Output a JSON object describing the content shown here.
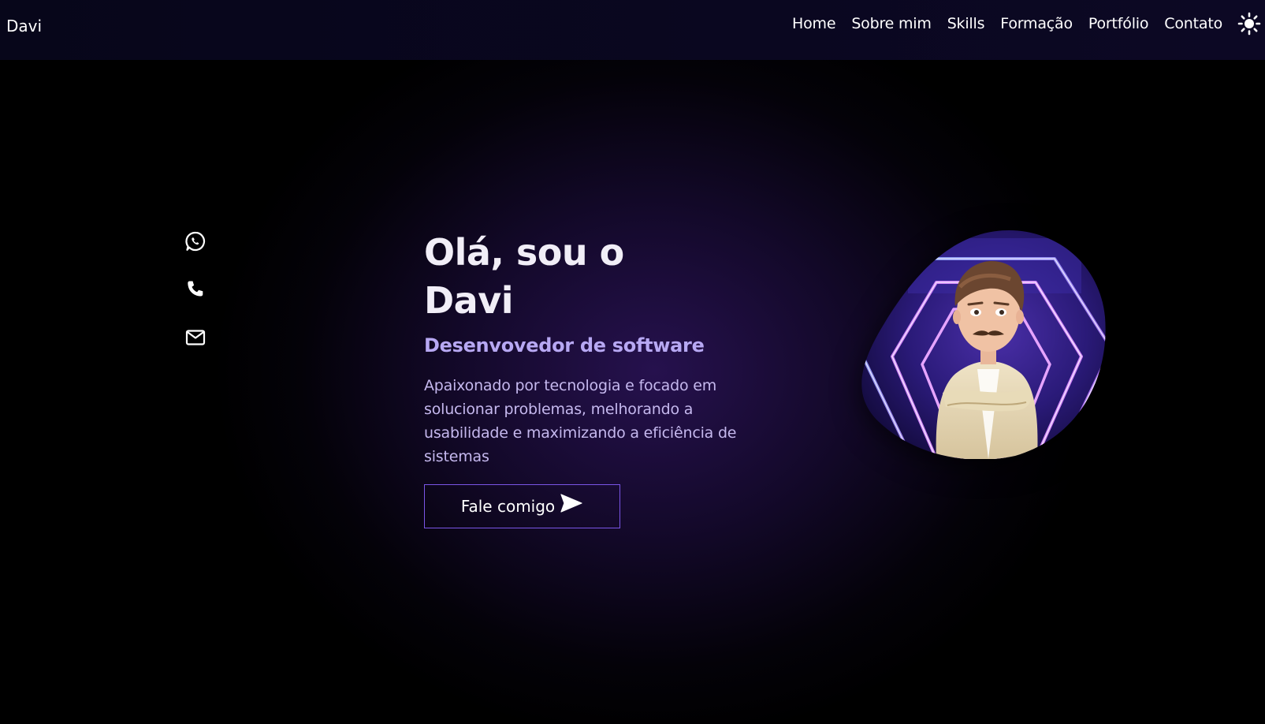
{
  "header": {
    "logo": "Davi",
    "nav": [
      {
        "label": "Home"
      },
      {
        "label": "Sobre mim"
      },
      {
        "label": "Skills"
      },
      {
        "label": "Formação"
      },
      {
        "label": "Portfólio"
      },
      {
        "label": "Contato"
      }
    ],
    "theme_toggle_icon": "sun-icon"
  },
  "socials": [
    {
      "icon": "whatsapp-icon"
    },
    {
      "icon": "phone-icon"
    },
    {
      "icon": "mail-icon"
    }
  ],
  "hero": {
    "title": "Olá, sou o Davi",
    "subtitle": "Desenvovedor de software",
    "description": "Apaixonado por tecnologia e focado em solucionar problemas, melhorando a usabilidade e maximizando a eficiência de sistemas",
    "cta_label": "Fale comigo",
    "cta_icon": "send-icon"
  },
  "avatar": {
    "icon": "avatar-illustration"
  },
  "colors": {
    "background": "#000000",
    "accent": "#7a55e6",
    "subtitle": "#b7a8f3",
    "text": "#c5b8ee"
  }
}
